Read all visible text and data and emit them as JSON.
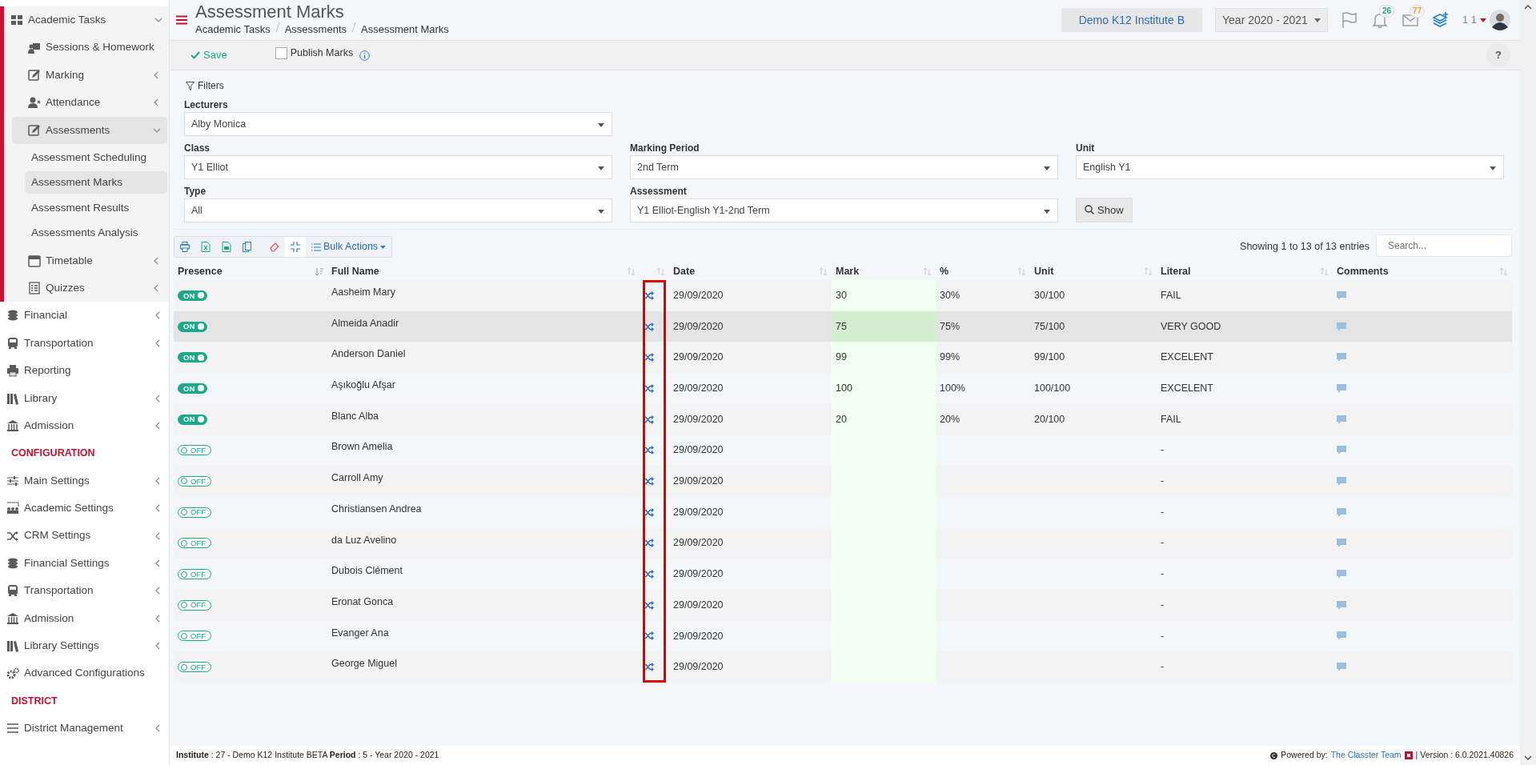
{
  "sidebar": {
    "items": [
      {
        "label": "Academic Tasks",
        "selected": true,
        "expanded": true,
        "children": [
          {
            "label": "Sessions & Homework",
            "selected": false,
            "expanded": false
          },
          {
            "label": "Marking",
            "selected": false,
            "expanded": false
          },
          {
            "label": "Attendance",
            "selected": false,
            "expanded": false
          },
          {
            "label": "Assessments",
            "selected": true,
            "expanded": true,
            "children": [
              {
                "label": "Assessment Scheduling",
                "selected": false
              },
              {
                "label": "Assessment Marks",
                "selected": true
              },
              {
                "label": "Assessment Results",
                "selected": false
              },
              {
                "label": "Assessments Analysis",
                "selected": false
              }
            ]
          },
          {
            "label": "Timetable",
            "selected": false,
            "expanded": false
          },
          {
            "label": "Quizzes",
            "selected": false,
            "expanded": false
          }
        ]
      },
      {
        "label": "Financial",
        "selected": false,
        "expanded": false
      },
      {
        "label": "Transportation",
        "selected": false,
        "expanded": false
      },
      {
        "label": "Reporting",
        "selected": false
      },
      {
        "label": "Library",
        "selected": false,
        "expanded": false
      },
      {
        "label": "Admission",
        "selected": false,
        "expanded": false
      },
      {
        "kind": "section",
        "label": "CONFIGURATION"
      },
      {
        "label": "Main Settings",
        "selected": false,
        "expanded": false
      },
      {
        "label": "Academic Settings",
        "selected": false,
        "expanded": false
      },
      {
        "label": "CRM Settings",
        "selected": false,
        "expanded": false
      },
      {
        "label": "Financial Settings",
        "selected": false,
        "expanded": false
      },
      {
        "label": "Transportation",
        "selected": false,
        "expanded": false
      },
      {
        "label": "Admission",
        "selected": false,
        "expanded": false
      },
      {
        "label": "Library Settings",
        "selected": false,
        "expanded": false
      },
      {
        "label": "Advanced Configurations",
        "selected": false
      },
      {
        "kind": "section",
        "label": "DISTRICT"
      },
      {
        "label": "District Management",
        "selected": false,
        "expanded": false
      }
    ]
  },
  "header": {
    "title": "Assessment Marks",
    "breadcrumb": [
      "Academic Tasks",
      "Assessments",
      "Assessment Marks"
    ],
    "institute": "Demo K12 Institute B",
    "year": "Year 2020 - 2021",
    "notifications": "26",
    "messages": "77",
    "user": "1 1"
  },
  "toolbar": {
    "save": "Save",
    "publish": {
      "label": "Publish Marks",
      "checked": false
    },
    "help": "?"
  },
  "filters": {
    "title": "Filters",
    "fields": [
      {
        "label": "Lecturers",
        "value": "Alby Monica"
      },
      {
        "label": "Class",
        "value": "Y1 Elliot"
      },
      {
        "label": "Marking Period",
        "value": "2nd Term"
      },
      {
        "label": "Unit",
        "value": "English Y1"
      },
      {
        "label": "Type",
        "value": "All"
      },
      {
        "label": "Assessment",
        "value": "Y1 Elliot-English Y1-2nd Term"
      }
    ],
    "show": "Show"
  },
  "table": {
    "bulk_actions": "Bulk Actions",
    "info": "Showing 1 to 13 of 13 entries",
    "search": {
      "placeholder": "Search..."
    },
    "columns": [
      {
        "label": "Presence",
        "sorted": true
      },
      {
        "label": "Full Name",
        "sorted": false
      },
      {
        "sorted": false
      },
      {
        "label": "Date",
        "sorted": false
      },
      {
        "label": "Mark",
        "sorted": false
      },
      {
        "label": "%",
        "sorted": false
      },
      {
        "label": "Unit",
        "sorted": false
      },
      {
        "label": "Literal",
        "sorted": false
      },
      {
        "label": "Comments",
        "sorted": false
      }
    ],
    "rows": [
      {
        "presence": {
          "on": true,
          "label": "ON"
        },
        "name": "Aasheim Mary",
        "date": "29/09/2020",
        "mark": "30",
        "percent": "30%",
        "unit": "30/100",
        "literal": "FAIL",
        "selected": false
      },
      {
        "presence": {
          "on": true,
          "label": "ON"
        },
        "name": "Almeida Anadir",
        "date": "29/09/2020",
        "mark": "75",
        "percent": "75%",
        "unit": "75/100",
        "literal": "VERY GOOD",
        "selected": true
      },
      {
        "presence": {
          "on": true,
          "label": "ON"
        },
        "name": "Anderson Daniel",
        "date": "29/09/2020",
        "mark": "99",
        "percent": "99%",
        "unit": "99/100",
        "literal": "EXCELENT",
        "selected": false
      },
      {
        "presence": {
          "on": true,
          "label": "ON"
        },
        "name": "Aşıkoğlu Afşar",
        "date": "29/09/2020",
        "mark": "100",
        "percent": "100%",
        "unit": "100/100",
        "literal": "EXCELENT",
        "selected": false
      },
      {
        "presence": {
          "on": true,
          "label": "ON"
        },
        "name": "Blanc Alba",
        "date": "29/09/2020",
        "mark": "20",
        "percent": "20%",
        "unit": "20/100",
        "literal": "FAIL",
        "selected": false
      },
      {
        "presence": {
          "on": false,
          "label": "OFF"
        },
        "name": "Brown Amelia",
        "date": "29/09/2020",
        "literal": "-",
        "selected": false
      },
      {
        "presence": {
          "on": false,
          "label": "OFF"
        },
        "name": "Carroll Amy",
        "date": "29/09/2020",
        "literal": "-",
        "selected": false
      },
      {
        "presence": {
          "on": false,
          "label": "OFF"
        },
        "name": "Christiansen Andrea",
        "date": "29/09/2020",
        "literal": "-",
        "selected": false
      },
      {
        "presence": {
          "on": false,
          "label": "OFF"
        },
        "name": "da Luz Avelino",
        "date": "29/09/2020",
        "literal": "-",
        "selected": false
      },
      {
        "presence": {
          "on": false,
          "label": "OFF"
        },
        "name": "Dubois Clément",
        "date": "29/09/2020",
        "literal": "-",
        "selected": false
      },
      {
        "presence": {
          "on": false,
          "label": "OFF"
        },
        "name": "Eronat Gonca",
        "date": "29/09/2020",
        "literal": "-",
        "selected": false
      },
      {
        "presence": {
          "on": false,
          "label": "OFF"
        },
        "name": "Evanger Ana",
        "date": "29/09/2020",
        "literal": "-",
        "selected": false
      },
      {
        "presence": {
          "on": false,
          "label": "OFF"
        },
        "name": "George Miguel",
        "date": "29/09/2020",
        "literal": "-",
        "selected": false
      }
    ]
  },
  "footer": {
    "info": "**Institute** : 27 - Demo K12 Institute BETA **Period** : 5 - Year 2020 - 2021",
    "powered": "Powered by:",
    "team": "The Classter Team",
    "version": "| Version : 6.0.2021.40826"
  }
}
